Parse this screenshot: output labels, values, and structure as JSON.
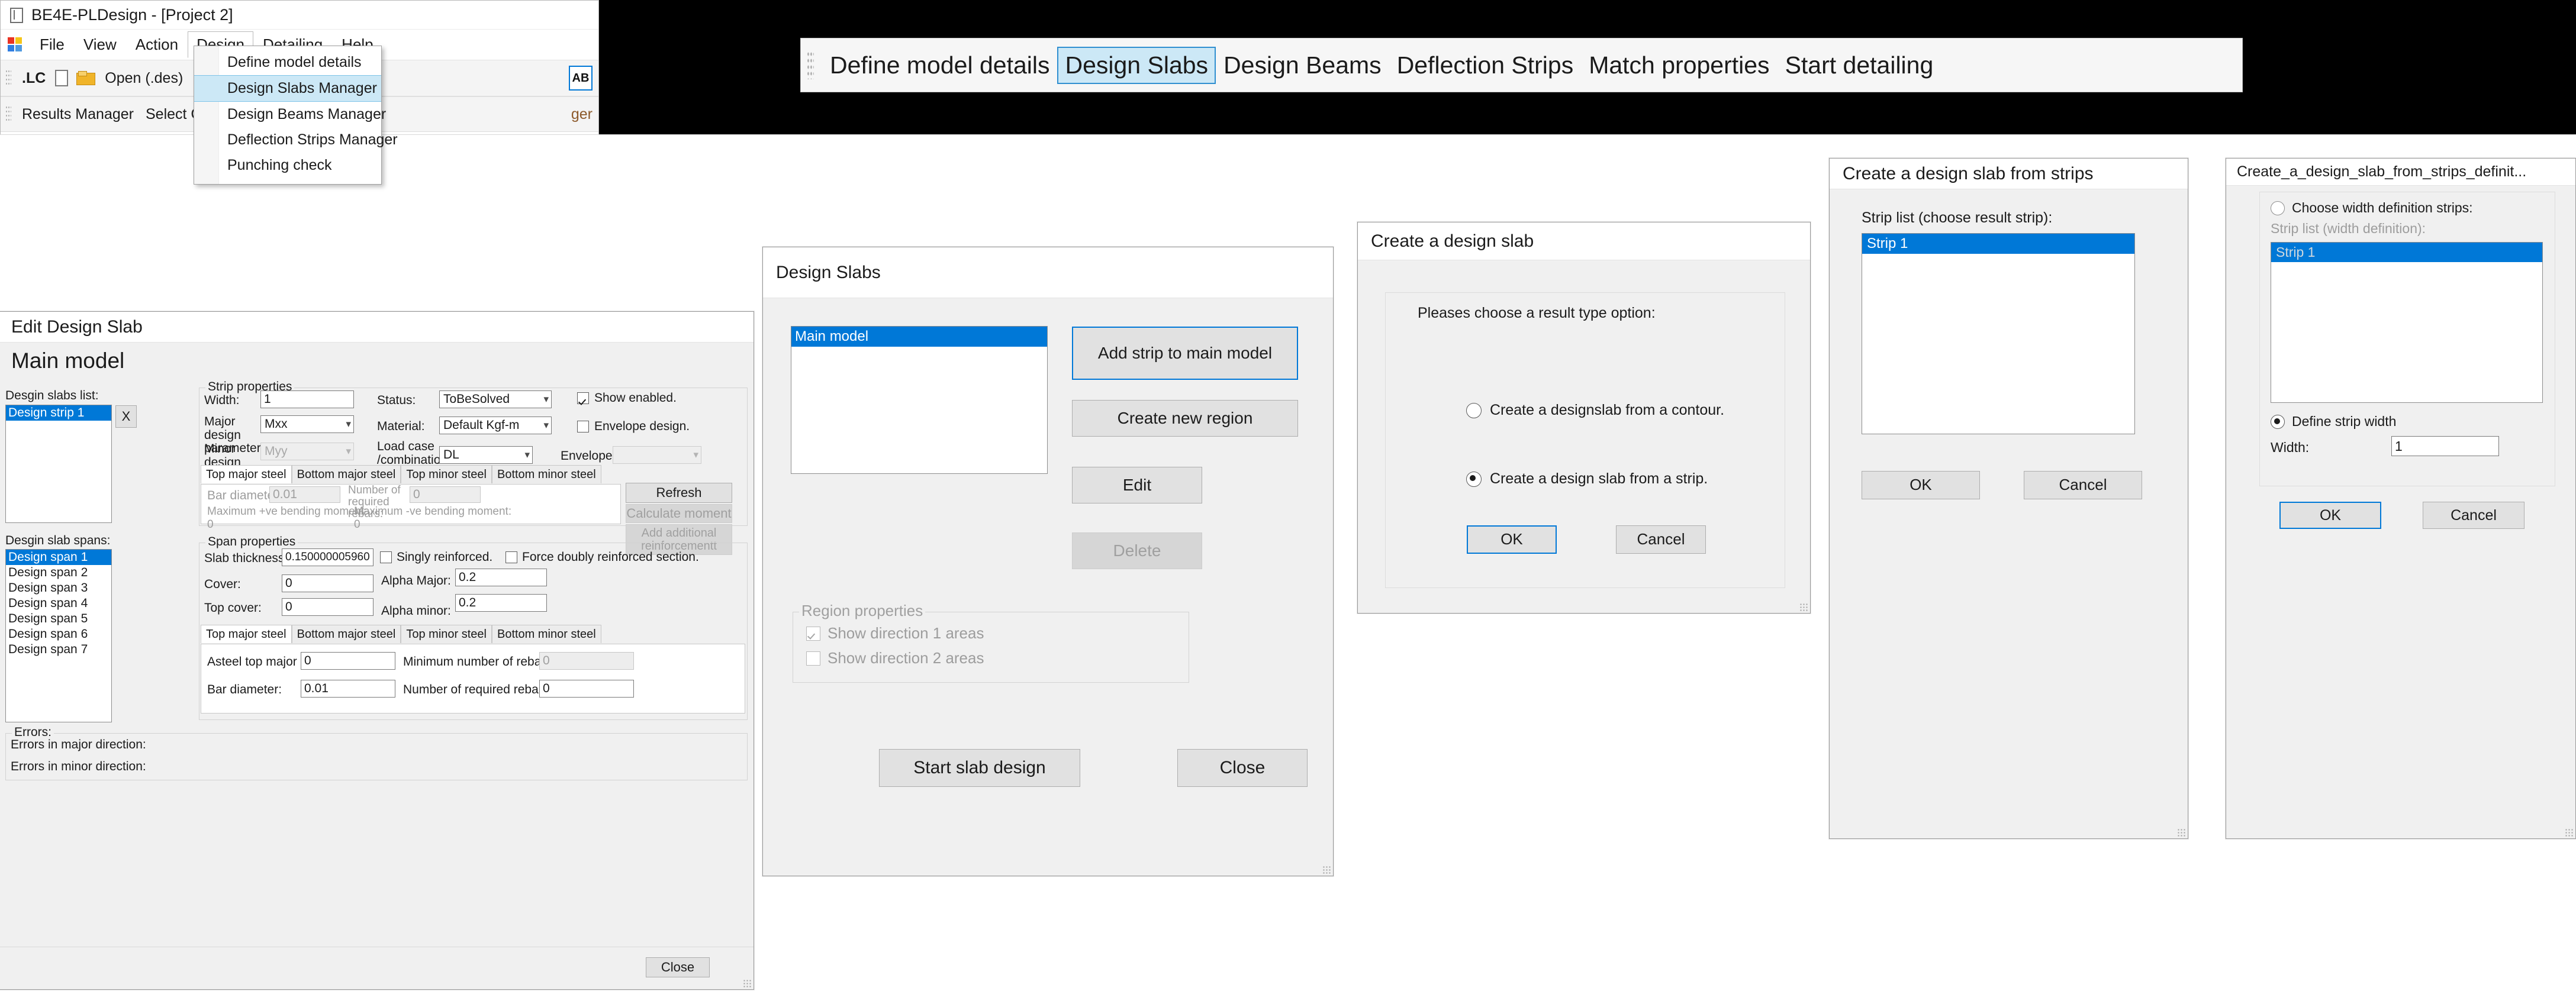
{
  "main_window": {
    "title": "BE4E-PLDesign - [Project 2]",
    "app_icon": "app-window-icon",
    "menu": [
      {
        "label": "File"
      },
      {
        "label": "View"
      },
      {
        "label": "Action"
      },
      {
        "label": "Design",
        "open": true
      },
      {
        "label": "Detailing"
      },
      {
        "label": "Help"
      }
    ],
    "toolbar_row1": [
      {
        "label": ".LC"
      },
      {
        "label": "Open (.des)"
      }
    ],
    "toolbar_row2": [
      {
        "label": "Results Manager"
      },
      {
        "label": "Select Cas"
      },
      {
        "label": "ger"
      }
    ],
    "ab_icon_label": "AB"
  },
  "design_menu": {
    "items": [
      {
        "label": "Define model details",
        "highlighted": false
      },
      {
        "label": "Design Slabs Manager",
        "highlighted": true
      },
      {
        "label": "Design Beams Manager",
        "highlighted": false
      },
      {
        "label": "Deflection Strips Manager",
        "highlighted": false
      },
      {
        "label": "Punching check",
        "highlighted": false
      }
    ]
  },
  "big_toolbar": {
    "items": [
      {
        "label": "Define model details",
        "active": false
      },
      {
        "label": "Design Slabs",
        "active": true
      },
      {
        "label": "Design Beams",
        "active": false
      },
      {
        "label": "Deflection Strips",
        "active": false
      },
      {
        "label": "Match properties",
        "active": false
      },
      {
        "label": "Start detailing",
        "active": false
      }
    ]
  },
  "edit_design_slab": {
    "title": "Edit Design Slab",
    "heading": "Main model",
    "slabs_list_label": "Desgin slabs list:",
    "slabs_list": [
      {
        "label": "Design strip 1",
        "selected": true
      }
    ],
    "remove_button": "X",
    "spans_list_label": "Desgin slab spans:",
    "spans_list": [
      {
        "label": "Design span 1",
        "selected": true
      },
      {
        "label": "Design span 2",
        "selected": false
      },
      {
        "label": "Design span 3",
        "selected": false
      },
      {
        "label": "Design span 4",
        "selected": false
      },
      {
        "label": "Design span 5",
        "selected": false
      },
      {
        "label": "Design span 6",
        "selected": false
      },
      {
        "label": "Design span 7",
        "selected": false
      }
    ],
    "strip_properties": {
      "group_title": "Strip properties",
      "width_label": "Width:",
      "width_value": "1",
      "major_design_label": "Major design parameter:",
      "major_design_value": "Mxx",
      "minor_design_label": "Minor design parameter:",
      "minor_design_value": "Myy",
      "status_label": "Status:",
      "status_value": "ToBeSolved",
      "material_label": "Material:",
      "material_value": "Default Kgf-m",
      "load_case_label": "Load case /combination:",
      "load_case_value": "DL",
      "show_enabled_label": "Show enabled.",
      "show_enabled_checked": true,
      "envelope_design_label": "Envelope design.",
      "envelope_design_checked": false,
      "envelope_label": "Envelope:",
      "envelope_value": "",
      "tabs": [
        {
          "label": "Top major steel",
          "active": true
        },
        {
          "label": "Bottom major steel",
          "active": false
        },
        {
          "label": "Top minor steel",
          "active": false
        },
        {
          "label": "Bottom minor steel",
          "active": false
        }
      ],
      "bar_diameter_label": "Bar diameter:",
      "bar_diameter_value": "0.01",
      "num_required_rebars_label": "Number of required rebars:",
      "num_required_rebars_value": "0",
      "max_pos_moment_label": "Maximum +ve bending moment:",
      "max_pos_moment_value": "0",
      "max_neg_moment_label": "Maximum -ve bending moment:",
      "max_neg_moment_value": "0",
      "refresh_button": "Refresh",
      "calculate_moment_button": "Calculate moment",
      "add_reinforcement_button": "Add additional reinforcementt"
    },
    "span_properties": {
      "group_title": "Span properties",
      "slab_thickness_label": "Slab thickness:",
      "slab_thickness_value": "0.150000005960",
      "singly_reinforced_label": "Singly reinforced.",
      "singly_reinforced_checked": false,
      "force_doubly_label": "Force doubly reinforced section.",
      "force_doubly_checked": false,
      "cover_label": "Cover:",
      "cover_value": "0",
      "alpha_major_label": "Alpha Major:",
      "alpha_major_value": "0.2",
      "top_cover_label": "Top cover:",
      "top_cover_value": "0",
      "alpha_minor_label": "Alpha minor:",
      "alpha_minor_value": "0.2",
      "tabs": [
        {
          "label": "Top major steel",
          "active": true
        },
        {
          "label": "Bottom major steel",
          "active": false
        },
        {
          "label": "Top minor steel",
          "active": false
        },
        {
          "label": "Bottom minor steel",
          "active": false
        }
      ],
      "asteel_label": "Asteel top major direction:",
      "asteel_value": "0",
      "min_rebars_label": "Minimum number of rebars:",
      "min_rebars_value": "0",
      "bar_diameter_label": "Bar diameter:",
      "bar_diameter_value": "0.01",
      "num_required_rebars_label": "Number of required rebars:",
      "num_required_rebars_value": "0"
    },
    "errors": {
      "group_title": "Errors:",
      "major_label": "Errors in major direction:",
      "minor_label": "Errors in minor direction:"
    },
    "close_button": "Close"
  },
  "design_slabs": {
    "title": "Design Slabs",
    "list": [
      {
        "label": "Main model",
        "selected": true
      }
    ],
    "buttons": {
      "add_strip": "Add strip to main model",
      "create_region": "Create new region",
      "edit": "Edit",
      "delete": "Delete",
      "start_slab_design": "Start slab design",
      "close": "Close"
    },
    "region_properties": {
      "group_title": "Region properties",
      "dir1_label": "Show direction 1 areas",
      "dir1_checked": true,
      "dir2_label": "Show direction 2 areas",
      "dir2_checked": false
    }
  },
  "create_design_slab": {
    "title": "Create a design slab",
    "prompt": "Pleases choose a result type option:",
    "options": [
      {
        "label": "Create a designslab from a contour.",
        "selected": false
      },
      {
        "label": "Create a design slab from a strip.",
        "selected": true
      }
    ],
    "ok_button": "OK",
    "cancel_button": "Cancel"
  },
  "create_from_strips": {
    "title": "Create a design slab from strips",
    "strip_list_label": "Strip list (choose result strip):",
    "strip_list": [
      {
        "label": "Strip 1",
        "selected": true
      }
    ],
    "ok_button": "OK",
    "cancel_button": "Cancel"
  },
  "strips_definition": {
    "title": "Create_a_design_slab_from_strips_definit...",
    "choose_width_label": "Choose width definition strips:",
    "choose_width_selected": false,
    "strip_list_label": "Strip list (width definition):",
    "strip_list": [
      {
        "label": "Strip 1",
        "selected": true
      }
    ],
    "define_width_label": "Define strip width",
    "define_width_selected": true,
    "width_label": "Width:",
    "width_value": "1",
    "ok_button": "OK",
    "cancel_button": "Cancel"
  },
  "colors": {
    "accent": "#0078d7",
    "selection": "#0078d7",
    "menu_highlight": "#cce8f6",
    "dialog_bg": "#f0f0f0"
  }
}
